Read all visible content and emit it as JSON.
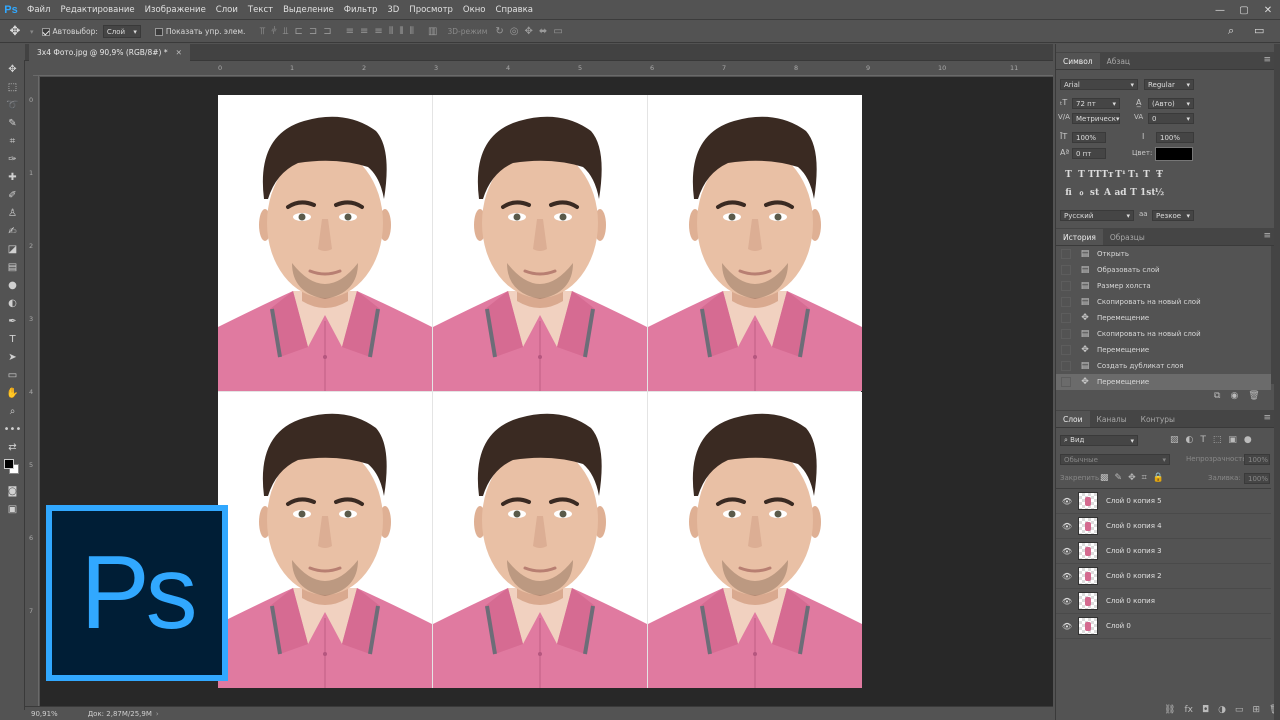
{
  "app": {
    "logo": "Ps",
    "menu": [
      "Файл",
      "Редактирование",
      "Изображение",
      "Слои",
      "Текст",
      "Выделение",
      "Фильтр",
      "3D",
      "Просмотр",
      "Окно",
      "Справка"
    ]
  },
  "options": {
    "autoselect_label": "Автовыбор:",
    "autoselect_value": "Слой",
    "show_controls_label": "Показать упр. элем.",
    "mode_3d": "3D-режим"
  },
  "document": {
    "tab_title": "3x4 Фото.jpg @ 90,9% (RGB/8#) *",
    "ruler_h": [
      "0",
      "1",
      "2",
      "3",
      "4",
      "5",
      "6",
      "7",
      "8",
      "9",
      "10",
      "11"
    ],
    "ruler_v": [
      "0",
      "1",
      "2",
      "3",
      "4",
      "5",
      "6",
      "7"
    ]
  },
  "status": {
    "zoom": "90,91%",
    "doc_size": "Док: 2,87M/25,9M"
  },
  "character": {
    "tabs": [
      "Символ",
      "Абзац"
    ],
    "font_family": "Arial",
    "font_style": "Regular",
    "font_size": "72 пт",
    "leading": "(Авто)",
    "kerning": "Метрическ",
    "tracking": "0",
    "vertical_scale": "100%",
    "horizontal_scale": "100%",
    "baseline_shift": "0 пт",
    "color_label": "Цвет:",
    "color_value": "#000000",
    "style_buttons_1": [
      "T",
      "T",
      "TT",
      "Tт",
      "T¹",
      "T₁",
      "T",
      "Ŧ"
    ],
    "style_buttons_2": [
      "fi",
      "ℴ",
      "st",
      "A",
      "ad",
      "T",
      "1st",
      "½"
    ],
    "language": "Русский",
    "antialias_icon": "aa",
    "antialias": "Резкое"
  },
  "history": {
    "tabs": [
      "История",
      "Образцы"
    ],
    "items": [
      {
        "label": "Открыть",
        "icon": "doc-icon"
      },
      {
        "label": "Образовать слой",
        "icon": "doc-icon"
      },
      {
        "label": "Размер холста",
        "icon": "doc-icon"
      },
      {
        "label": "Скопировать на новый слой",
        "icon": "doc-icon"
      },
      {
        "label": "Перемещение",
        "icon": "move-icon"
      },
      {
        "label": "Скопировать на новый слой",
        "icon": "doc-icon"
      },
      {
        "label": "Перемещение",
        "icon": "move-icon"
      },
      {
        "label": "Создать дубликат слоя",
        "icon": "doc-icon"
      },
      {
        "label": "Перемещение",
        "icon": "move-icon"
      }
    ],
    "selected_index": 8
  },
  "layers": {
    "tabs": [
      "Слои",
      "Каналы",
      "Контуры"
    ],
    "filter_label": "Вид",
    "blend_mode": "Обычные",
    "opacity_label": "Непрозрачность:",
    "opacity": "100%",
    "lock_label": "Закрепить:",
    "fill_label": "Заливка:",
    "fill": "100%",
    "items": [
      "Слой 0 копия 5",
      "Слой 0 копия 4",
      "Слой 0 копия 3",
      "Слой 0 копия 2",
      "Слой 0 копия",
      "Слой 0"
    ]
  },
  "colors": {
    "accent": "#31a8ff",
    "logo_bg": "#001e36",
    "shirt": "#e07aa0",
    "hair": "#3a2a22",
    "skin": "#e9c0a5"
  }
}
